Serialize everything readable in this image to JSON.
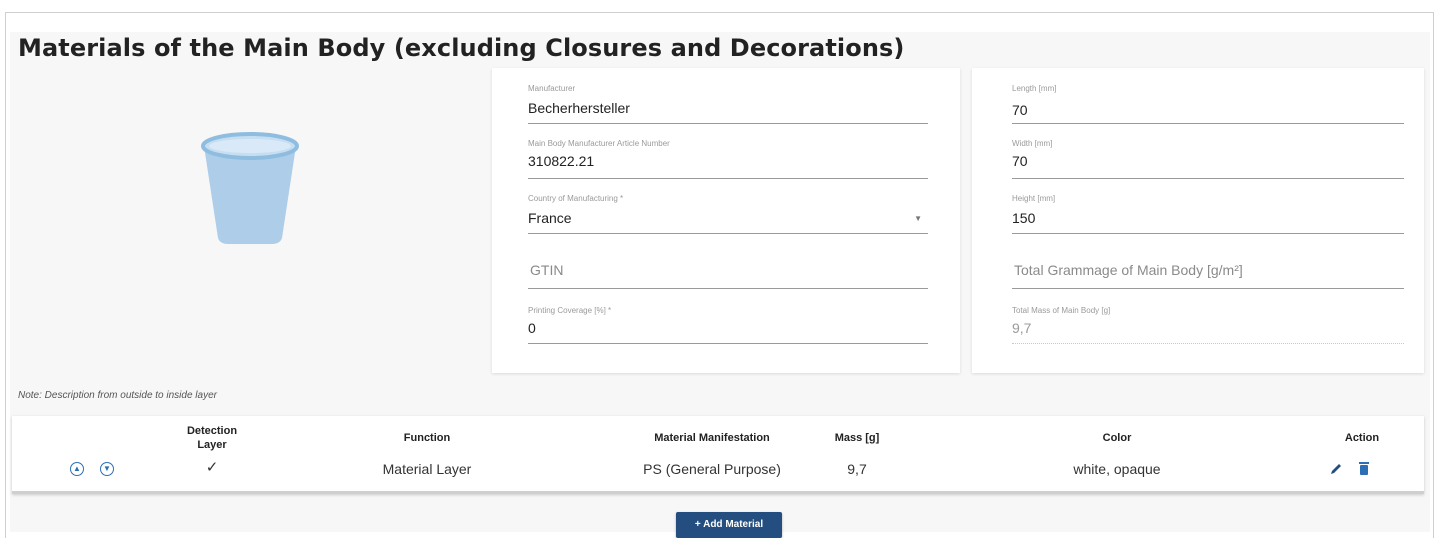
{
  "section": {
    "title": "Materials of the Main Body (excluding Closures and Decorations)",
    "note": "Note: Description from outside to inside layer"
  },
  "fields_left": {
    "manufacturer": {
      "label": "Manufacturer",
      "value": "Becherhersteller"
    },
    "article_number": {
      "label": "Main Body Manufacturer Article Number",
      "value": "310822.21"
    },
    "country": {
      "label": "Country of Manufacturing *",
      "value": "France"
    },
    "gtin": {
      "placeholder": "GTIN"
    },
    "printing": {
      "label": "Printing Coverage [%] *",
      "value": "0"
    }
  },
  "fields_right": {
    "length": {
      "label": "Length [mm]",
      "value": "70"
    },
    "width": {
      "label": "Width [mm]",
      "value": "70"
    },
    "height": {
      "label": "Height [mm]",
      "value": "150"
    },
    "grammage": {
      "placeholder": "Total Grammage of Main Body [g/m²]"
    },
    "mass": {
      "label": "Total Mass of Main Body [g]",
      "value": "9,7"
    }
  },
  "table": {
    "headers": {
      "detection_line1": "Detection",
      "detection_line2": "Layer",
      "function": "Function",
      "manifestation": "Material Manifestation",
      "mass": "Mass [g]",
      "color": "Color",
      "action": "Action"
    },
    "rows": [
      {
        "detection": "✓",
        "function": "Material Layer",
        "manifestation": "PS (General Purpose)",
        "mass": "9,7",
        "color": "white, opaque"
      }
    ]
  },
  "add_button": {
    "label": "+ Add Material"
  },
  "icons": {
    "cup": "cup-icon",
    "move_up": "arrow-up-circle-icon",
    "move_down": "arrow-down-circle-icon",
    "edit": "pencil-icon",
    "delete": "trash-icon",
    "dropdown": "caret-down-icon"
  },
  "colors": {
    "accent": "#2c6fb5",
    "button": "#234e7f",
    "cup_fill": "#aecde8",
    "cup_rim": "#8fbde0"
  }
}
